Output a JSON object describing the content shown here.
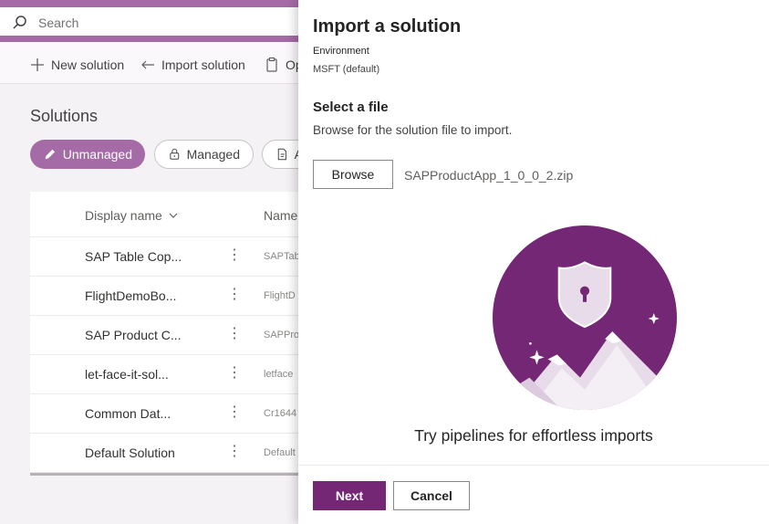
{
  "topbar": {
    "search_placeholder": "Search"
  },
  "commandbar": {
    "new_solution": "New solution",
    "import_solution": "Import solution",
    "publish_partial": "Op"
  },
  "page": {
    "title": "Solutions",
    "filters": [
      {
        "label": "Unmanaged",
        "icon": "pencil-icon"
      },
      {
        "label": "Managed",
        "icon": "lock-icon"
      },
      {
        "label": "A",
        "icon": "document-icon"
      }
    ]
  },
  "grid": {
    "col_display_name": "Display name",
    "col_name": "Name",
    "rows": [
      {
        "display": "SAP Table Cop...",
        "name": "SAPTab"
      },
      {
        "display": "FlightDemoBo...",
        "name": "FlightD"
      },
      {
        "display": "SAP Product C...",
        "name": "SAPPro"
      },
      {
        "display": "let-face-it-sol...",
        "name": "letface"
      },
      {
        "display": "Common Dat...",
        "name": "Cr1644"
      },
      {
        "display": "Default Solution",
        "name": "Default"
      }
    ]
  },
  "panel": {
    "title": "Import a solution",
    "env_label": "Environment",
    "env_value": "MSFT (default)",
    "select_title": "Select a file",
    "select_desc": "Browse for the solution file to import.",
    "browse": "Browse",
    "file_name": "SAPProductApp_1_0_0_2.zip",
    "promo": "Try pipelines for effortless imports",
    "next": "Next",
    "cancel": "Cancel"
  },
  "colors": {
    "brand": "#742774",
    "accent": "#a56ba7",
    "illustration": "#742774"
  }
}
